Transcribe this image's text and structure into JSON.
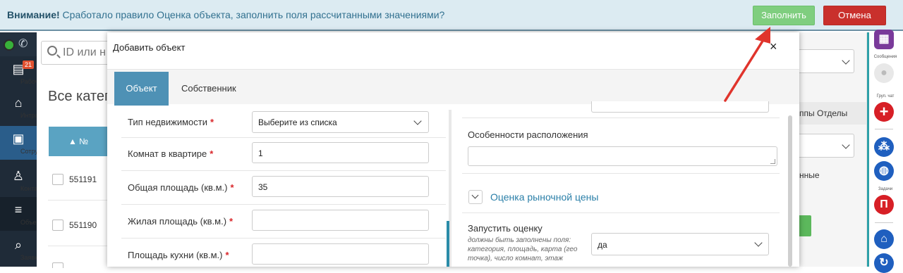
{
  "alert": {
    "prefix": "Внимание!",
    "message": "Сработало правило Оценка объекта, заполнить поля рассчитанными значениями?",
    "fill_label": "Заполнить",
    "cancel_label": "Отмена"
  },
  "leftnav": {
    "badge": "21",
    "items": [
      {
        "label": "Рабочи..."
      },
      {
        "label": "Интранет"
      },
      {
        "label": "Сотрудн..."
      },
      {
        "label": "Контакты"
      },
      {
        "label": "Объекты"
      },
      {
        "label": "Заявки"
      }
    ]
  },
  "background": {
    "search_placeholder": "ID или н",
    "title": "Все катег",
    "column_header": "▲ №",
    "rows": [
      "551191",
      "551190"
    ],
    "tabs_text": "ппы  Отделы",
    "text": "нные"
  },
  "rightrail": {
    "labels": [
      "Сообщения",
      "Груп. чат",
      "Задачи"
    ]
  },
  "modal": {
    "title": "Добавить объект",
    "close": "×",
    "tabs": [
      "Объект",
      "Собственник"
    ],
    "fields": [
      {
        "label": "Тип недвижимости",
        "value": "Выберите из списка",
        "required": "*"
      },
      {
        "label": "Комнат в квартире",
        "value": "1",
        "required": "*"
      },
      {
        "label": "Общая площадь (кв.м.)",
        "value": "35",
        "required": "*"
      },
      {
        "label": "Жилая площадь (кв.м.)",
        "value": "",
        "required": "*"
      },
      {
        "label": "Площадь кухни (кв.м.)",
        "value": "",
        "required": "*"
      }
    ],
    "right": {
      "location_label": "Особенности расположения",
      "section_title": "Оценка рыночной цены",
      "run_label": "Запустить оценку",
      "run_hint": "должны быть заполнены поля: категория, площадь, карта (гео точка), число комнат, этаж",
      "run_value": "да"
    }
  }
}
